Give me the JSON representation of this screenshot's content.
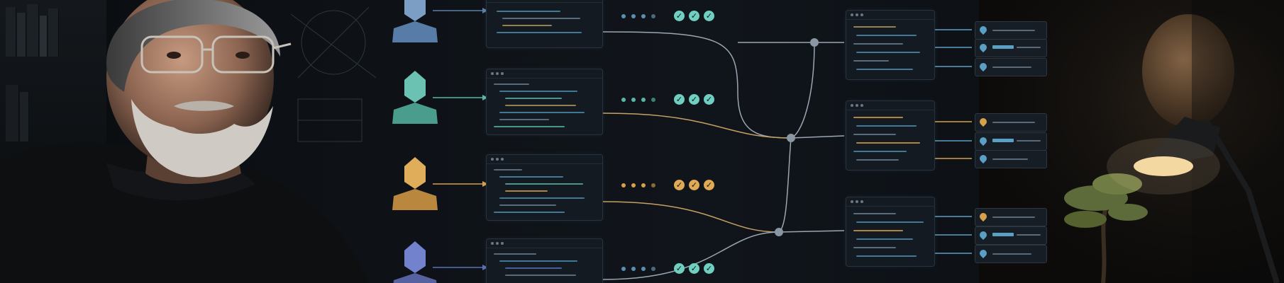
{
  "scene": {
    "accent_teal": "#58b7a8",
    "accent_gold": "#d6a04c",
    "accent_blue": "#5a6fb5",
    "accent_slate": "#5b7fa6",
    "check_teal": "#6fd0c2",
    "check_gold": "#e0aa55"
  },
  "icons": {
    "avatar": "low-poly-bust-icon",
    "check": "check-icon",
    "merge_node": "node-dot-icon",
    "location_pin": "pin-icon",
    "lamp": "desk-lamp-icon",
    "bonsai": "bonsai-tree-icon"
  },
  "check_glyph": "✓"
}
